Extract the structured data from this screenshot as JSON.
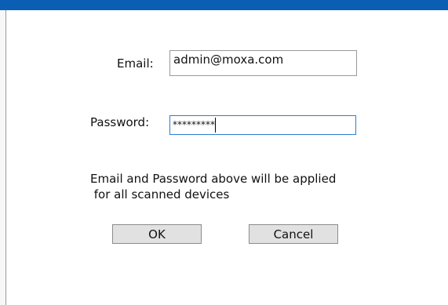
{
  "form": {
    "email_label": "Email:",
    "email_value": "admin@moxa.com",
    "password_label": "Password:",
    "password_value": "*********",
    "note_line1": "Email and Password above will be applied",
    "note_line2": " for all scanned devices"
  },
  "buttons": {
    "ok_label": "OK",
    "cancel_label": "Cancel"
  },
  "colors": {
    "title_bar": "#0a5fb4",
    "focus_border": "#2a7fd1",
    "button_face": "#e1e1e1"
  }
}
